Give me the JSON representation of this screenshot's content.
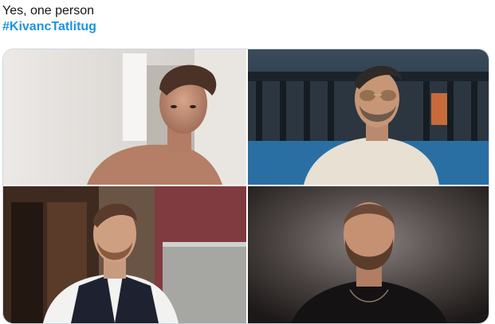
{
  "tweet": {
    "text_line1": "Yes, one person",
    "hashtag": "#KivancTatlitug"
  },
  "media": {
    "photos": [
      {
        "position": "top-left",
        "description_icon": "photo-icon"
      },
      {
        "position": "top-right",
        "description_icon": "photo-icon"
      },
      {
        "position": "bottom-left",
        "description_icon": "photo-icon"
      },
      {
        "position": "bottom-right",
        "description_icon": "photo-icon"
      }
    ]
  }
}
